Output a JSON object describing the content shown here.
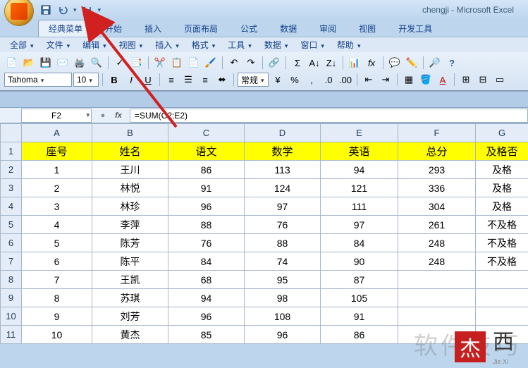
{
  "app": {
    "filename": "chengji",
    "product": "Microsoft Excel"
  },
  "qat": [
    "save-icon",
    "undo-icon",
    "redo-icon"
  ],
  "ribbon_tabs": [
    {
      "label": "经典菜单",
      "active": true
    },
    {
      "label": "开始"
    },
    {
      "label": "插入"
    },
    {
      "label": "页面布局"
    },
    {
      "label": "公式"
    },
    {
      "label": "数据"
    },
    {
      "label": "审阅"
    },
    {
      "label": "视图"
    },
    {
      "label": "开发工具"
    }
  ],
  "submenus": [
    "全部",
    "文件",
    "编辑",
    "视图",
    "插入",
    "格式",
    "工具",
    "数据",
    "窗口",
    "帮助"
  ],
  "font": {
    "name": "Tahoma",
    "size": "10",
    "style_label": "常规"
  },
  "formula_bar": {
    "cell_ref": "F2",
    "formula": "=SUM(C2:E2)",
    "fx_label": "fx"
  },
  "columns": [
    "A",
    "B",
    "C",
    "D",
    "E",
    "F",
    "G"
  ],
  "headers": [
    "座号",
    "姓名",
    "语文",
    "数学",
    "英语",
    "总分",
    "及格否"
  ],
  "rows": [
    [
      "1",
      "王川",
      "86",
      "113",
      "94",
      "293",
      "及格"
    ],
    [
      "2",
      "林悦",
      "91",
      "124",
      "121",
      "336",
      "及格"
    ],
    [
      "3",
      "林珍",
      "96",
      "97",
      "111",
      "304",
      "及格"
    ],
    [
      "4",
      "李萍",
      "88",
      "76",
      "97",
      "261",
      "不及格"
    ],
    [
      "5",
      "陈芳",
      "76",
      "88",
      "84",
      "248",
      "不及格"
    ],
    [
      "6",
      "陈平",
      "84",
      "74",
      "90",
      "248",
      "不及格"
    ],
    [
      "7",
      "王凯",
      "68",
      "95",
      "87",
      "",
      ""
    ],
    [
      "8",
      "苏琪",
      "94",
      "98",
      "105",
      "",
      ""
    ],
    [
      "9",
      "刘芳",
      "96",
      "108",
      "91",
      "",
      ""
    ],
    [
      "10",
      "黄杰",
      "85",
      "96",
      "86",
      "",
      ""
    ]
  ],
  "watermark": {
    "bg_text": "软件技巧",
    "stamp": "杰",
    "xi": "西",
    "sub": "Jie Xi"
  }
}
